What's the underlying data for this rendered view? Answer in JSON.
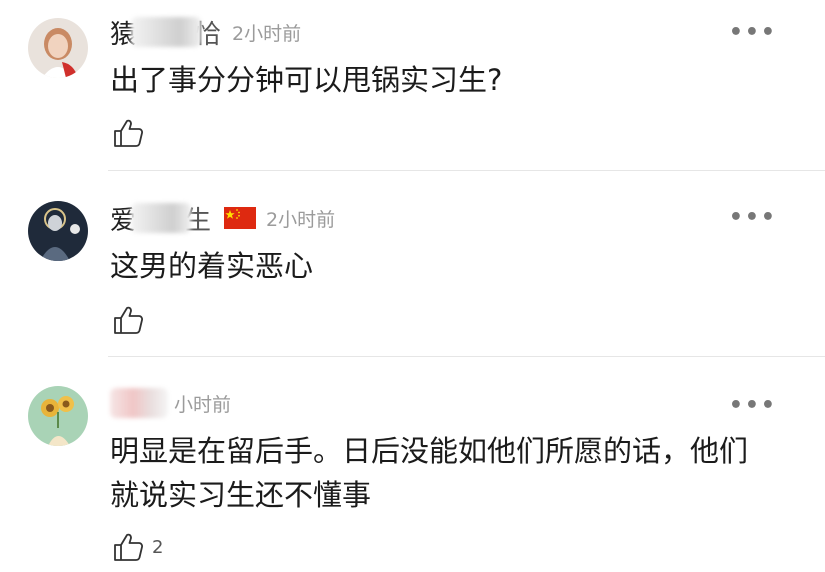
{
  "comments": [
    {
      "name_visible": "猿",
      "name_tail": "恰",
      "time": "2小时前",
      "text": "出了事分分钟可以甩锅实习生?",
      "like_count": "",
      "more_icon": "more-dots-icon",
      "like_icon": "thumbs-up-icon"
    },
    {
      "name_visible": "爱",
      "name_tail": "生",
      "time": "2小时前",
      "flag_icon": "china-flag-icon",
      "text": "这男的着实恶心",
      "like_count": "",
      "more_icon": "more-dots-icon",
      "like_icon": "thumbs-up-icon"
    },
    {
      "name_visible": "",
      "name_tail": "",
      "time": "小时前",
      "text_lines": [
        "明显是在留后手。日后没能如他们所愿的话，他们",
        "就说实习生还不懂事"
      ],
      "like_count": "2",
      "more_icon": "more-dots-icon",
      "like_icon": "thumbs-up-icon"
    }
  ],
  "colors": {
    "time": "#9b9b9b",
    "text": "#1b1b1b",
    "divider": "#e6e6e6",
    "flag_red": "#de2910",
    "flag_yellow": "#ffde00"
  }
}
